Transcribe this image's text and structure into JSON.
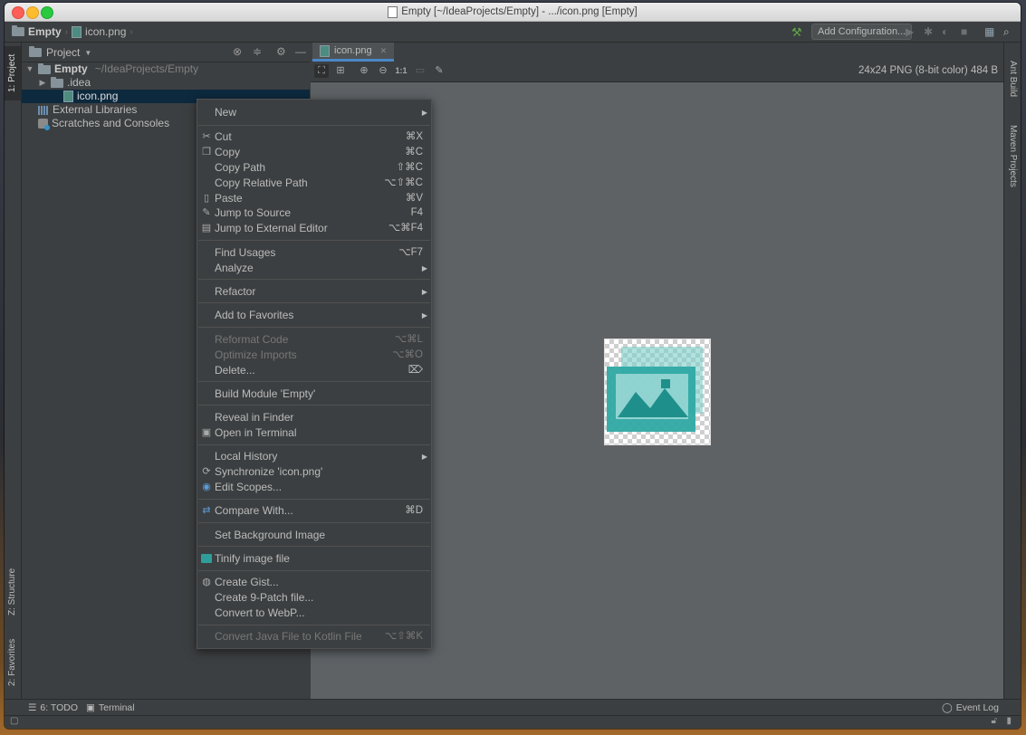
{
  "window": {
    "title": "Empty [~/IdeaProjects/Empty] - .../icon.png [Empty]"
  },
  "navbar": {
    "project": "Empty",
    "file": "icon.png",
    "add_config_label": "Add Configuration..."
  },
  "left_tabs": {
    "project": "1: Project",
    "structure": "Z: Structure",
    "favorites": "2: Favorites"
  },
  "right_tabs": {
    "ant": "Ant Build",
    "maven": "Maven Projects"
  },
  "project_panel": {
    "title": "Project",
    "tree": [
      {
        "label": "Empty",
        "path": "~/IdeaProjects/Empty"
      },
      {
        "label": ".idea"
      },
      {
        "label": "icon.png"
      },
      {
        "label": "External Libraries"
      },
      {
        "label": "Scratches and Consoles"
      }
    ]
  },
  "editor": {
    "tab_label": "icon.png",
    "toolbar": {
      "actual_size_label": "1:1"
    },
    "image_info": "24x24 PNG (8-bit color) 484 B"
  },
  "bottom": {
    "todo": "6: TODO",
    "terminal": "Terminal",
    "event_log": "Event Log"
  },
  "context_menu": {
    "items": [
      {
        "label": "New",
        "shortcut": ""
      },
      {
        "label": "Cut",
        "shortcut": "⌘X"
      },
      {
        "label": "Copy",
        "shortcut": "⌘C"
      },
      {
        "label": "Copy Path",
        "shortcut": "⇧⌘C"
      },
      {
        "label": "Copy Relative Path",
        "shortcut": "⌥⇧⌘C"
      },
      {
        "label": "Paste",
        "shortcut": "⌘V"
      },
      {
        "label": "Jump to Source",
        "shortcut": "F4"
      },
      {
        "label": "Jump to External Editor",
        "shortcut": "⌥⌘F4"
      },
      {
        "label": "Find Usages",
        "shortcut": "⌥F7"
      },
      {
        "label": "Analyze",
        "shortcut": ""
      },
      {
        "label": "Refactor",
        "shortcut": ""
      },
      {
        "label": "Add to Favorites",
        "shortcut": ""
      },
      {
        "label": "Reformat Code",
        "shortcut": "⌥⌘L"
      },
      {
        "label": "Optimize Imports",
        "shortcut": "⌥⌘O"
      },
      {
        "label": "Delete...",
        "shortcut": "⌦"
      },
      {
        "label": "Build Module 'Empty'",
        "shortcut": ""
      },
      {
        "label": "Reveal in Finder",
        "shortcut": ""
      },
      {
        "label": "Open in Terminal",
        "shortcut": ""
      },
      {
        "label": "Local History",
        "shortcut": ""
      },
      {
        "label": "Synchronize 'icon.png'",
        "shortcut": ""
      },
      {
        "label": "Edit Scopes...",
        "shortcut": ""
      },
      {
        "label": "Compare With...",
        "shortcut": "⌘D"
      },
      {
        "label": "Set Background Image",
        "shortcut": ""
      },
      {
        "label": "Tinify image file",
        "shortcut": ""
      },
      {
        "label": "Create Gist...",
        "shortcut": ""
      },
      {
        "label": "Create 9-Patch file...",
        "shortcut": ""
      },
      {
        "label": "Convert to WebP...",
        "shortcut": ""
      },
      {
        "label": "Convert Java File to Kotlin File",
        "shortcut": "⌥⇧⌘K"
      }
    ]
  },
  "colors": {
    "background": "#3c3f41",
    "editor_bg": "#5e6265",
    "selection": "#0d293e",
    "accent_teal": "#2f9e9a"
  }
}
